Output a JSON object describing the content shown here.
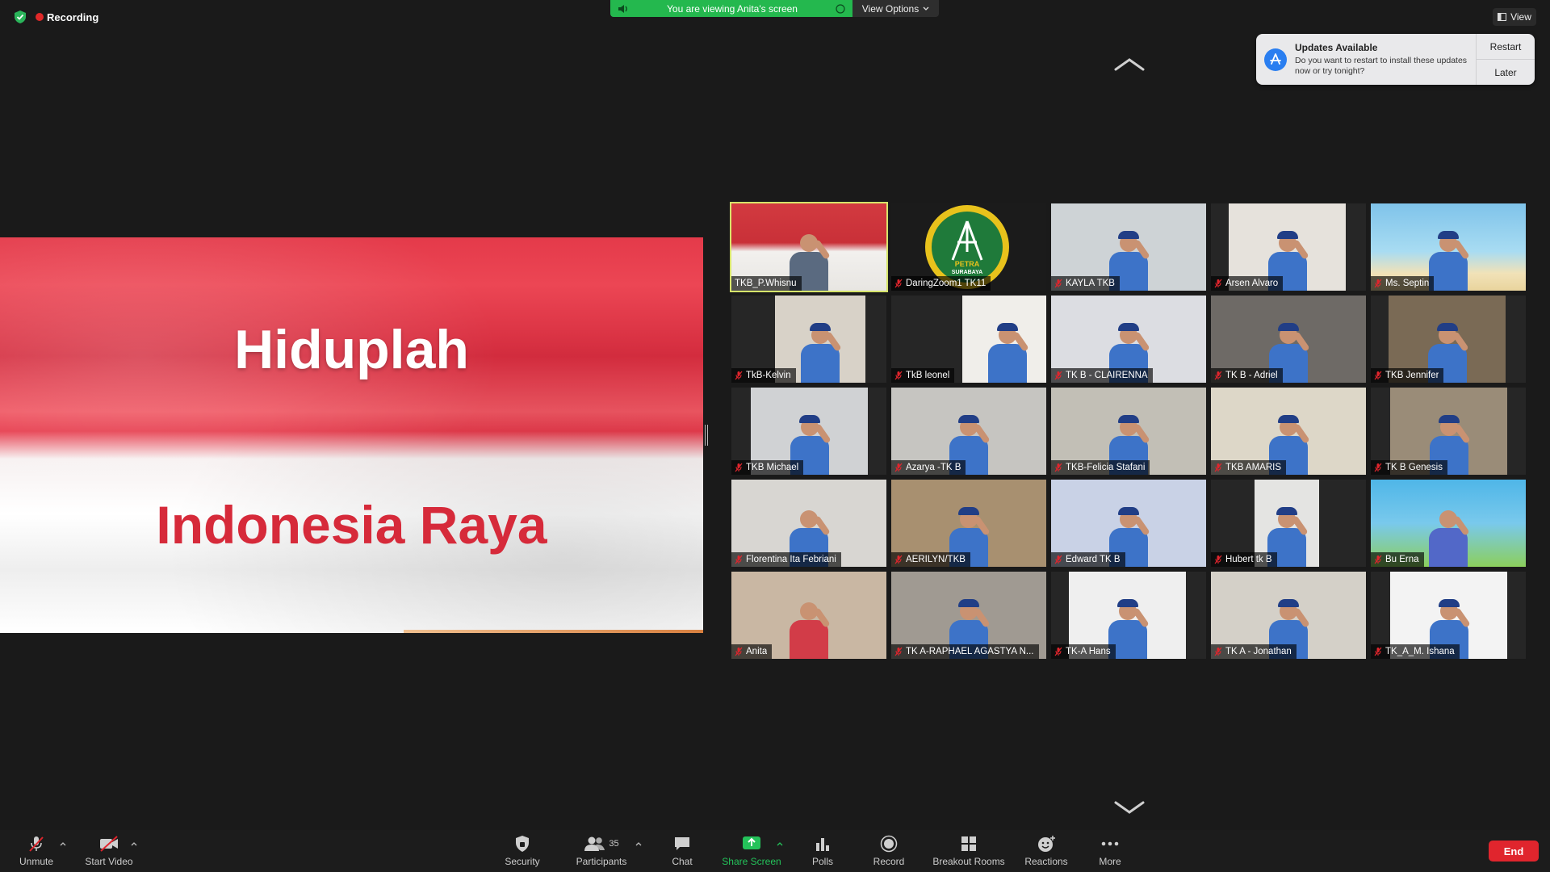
{
  "top_bar": {
    "recording_label": "Recording",
    "viewing_banner": "You are viewing Anita's screen",
    "view_options_label": "View Options",
    "view_label": "View"
  },
  "notification": {
    "title": "Updates Available",
    "message": "Do you want to restart to install these updates now or try tonight?",
    "restart_label": "Restart",
    "later_label": "Later",
    "icon": "app-store-icon"
  },
  "shared_screen": {
    "line1": "Hiduplah",
    "line2": "Indonesia Raya"
  },
  "gallery": {
    "tiles": [
      {
        "name": "TKB_P.Whisnu"
      },
      {
        "name": "DaringZoom1 TK11"
      },
      {
        "name": "KAYLA TKB"
      },
      {
        "name": "Arsen Alvaro"
      },
      {
        "name": "Ms. Septin"
      },
      {
        "name": "TkB-Kelvin"
      },
      {
        "name": "TkB leonel"
      },
      {
        "name": "TK B - CLAIRENNA"
      },
      {
        "name": "TK B - Adriel"
      },
      {
        "name": "TKB Jennifer"
      },
      {
        "name": "TKB Michael"
      },
      {
        "name": "Azarya -TK B"
      },
      {
        "name": "TKB-Felicia Stafani"
      },
      {
        "name": "TKB AMARIS"
      },
      {
        "name": "TK B Genesis"
      },
      {
        "name": "Florentina Ita Febriani"
      },
      {
        "name": "AERILYN/TKB"
      },
      {
        "name": "Edward TK B"
      },
      {
        "name": "Hubert tk B"
      },
      {
        "name": "Bu Erna"
      },
      {
        "name": "Anita"
      },
      {
        "name": "TK A-RAPHAEL AGASTYA N..."
      },
      {
        "name": "TK-A Hans"
      },
      {
        "name": "TK A - Jonathan"
      },
      {
        "name": "TK_A_M. Ishana"
      }
    ],
    "logo_text": "PETRA",
    "logo_subtext": "SURABAYA"
  },
  "toolbar": {
    "unmute": "Unmute",
    "start_video": "Start Video",
    "security": "Security",
    "participants": "Participants",
    "participants_count": "35",
    "chat": "Chat",
    "share_screen": "Share Screen",
    "polls": "Polls",
    "record": "Record",
    "breakout_rooms": "Breakout Rooms",
    "reactions": "Reactions",
    "more": "More",
    "end": "End"
  },
  "colors": {
    "share_green": "#24b84e",
    "end_red": "#e0252d",
    "active_speaker": "#d6e46a",
    "flag_red": "#e43a4a"
  }
}
